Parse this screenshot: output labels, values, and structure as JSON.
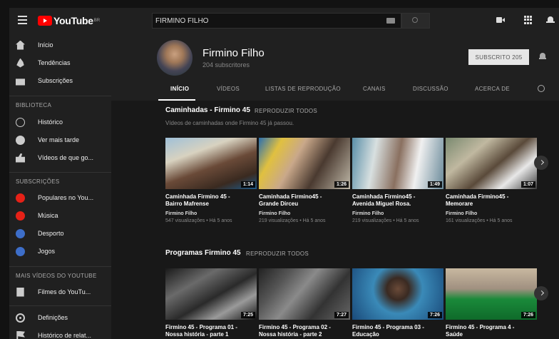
{
  "app": {
    "logo_text": "YouTube",
    "logo_region": "BR"
  },
  "search": {
    "value": "FIRMINO FILHO"
  },
  "sidebar": {
    "main_items": [
      {
        "label": "Início",
        "icon": "home-icon"
      },
      {
        "label": "Tendências",
        "icon": "trending-icon"
      },
      {
        "label": "Subscrições",
        "icon": "subscriptions-icon"
      }
    ],
    "library_title": "BIBLIOTECA",
    "library_items": [
      {
        "label": "Histórico",
        "icon": "history-icon"
      },
      {
        "label": "Ver mais tarde",
        "icon": "watch-later-icon"
      },
      {
        "label": "Vídeos de que go...",
        "icon": "liked-icon"
      }
    ],
    "subs_title": "SUBSCRIÇÕES",
    "subs_items": [
      {
        "label": "Populares no You...",
        "color": "#e62117"
      },
      {
        "label": "Música",
        "color": "#e62117"
      },
      {
        "label": "Desporto",
        "color": "#3d6ec9"
      },
      {
        "label": "Jogos",
        "color": "#3d6ec9"
      }
    ],
    "more_title": "MAIS VÍDEOS DO YOUTUBE",
    "more_items": [
      {
        "label": "Filmes do YouTu...",
        "icon": "film-icon"
      }
    ],
    "bottom_items": [
      {
        "label": "Definições",
        "icon": "settings-icon"
      },
      {
        "label": "Histórico de relat...",
        "icon": "flag-icon"
      }
    ]
  },
  "channel": {
    "name": "Firmino Filho",
    "subscribers": "204 subscritores",
    "subscribe_label": "SUBSCRITO",
    "subscribe_count": "205",
    "tabs": [
      "INÍCIO",
      "VÍDEOS",
      "LISTAS DE REPRODUÇÃO",
      "CANAIS",
      "DISCUSSÃO",
      "ACERCA DE"
    ]
  },
  "shelves": [
    {
      "title": "Caminhadas - Firmino 45",
      "play_all": "REPRODUZIR TODOS",
      "description": "Vídeos de caminhadas onde Firmino 45 já passou.",
      "videos": [
        {
          "title_line1": "Caminhada Firmino 45 -",
          "title_line2": "Bairro Mafrense",
          "channel": "Firmino Filho",
          "meta": "547 visualizações • Há 5 anos",
          "duration": "1:14"
        },
        {
          "title_line1": "Caminhada Firmino45 -",
          "title_line2": "Grande Dirceu",
          "channel": "Firmino Filho",
          "meta": "219 visualizações • Há 5 anos",
          "duration": "1:26"
        },
        {
          "title_line1": "Caminhada Firmino45 -",
          "title_line2": "Avenida Miguel Rosa.",
          "channel": "Firmino Filho",
          "meta": "219 visualizações • Há 5 anos",
          "duration": "1:49"
        },
        {
          "title_line1": "Caminhada Firmino45 -",
          "title_line2": "Memorare",
          "channel": "Firmino Filho",
          "meta": "161 visualizações • Há 5 anos",
          "duration": "1:07"
        }
      ]
    },
    {
      "title": "Programas Firmino 45",
      "play_all": "REPRODUZIR TODOS",
      "videos": [
        {
          "title_line1": "Firmino 45 - Programa 01 -",
          "title_line2": "Nossa história - parte 1",
          "duration": "7:25"
        },
        {
          "title_line1": "Firmino 45 - Programa 02 -",
          "title_line2": "Nossa história - parte 2",
          "duration": "7:27"
        },
        {
          "title_line1": "Firmino 45 - Programa 03 -",
          "title_line2": "Educação",
          "duration": "7:26"
        },
        {
          "title_line1": "Firmino 45 - Programa 4 -",
          "title_line2": "Saúde",
          "duration": "7:26"
        }
      ]
    }
  ]
}
